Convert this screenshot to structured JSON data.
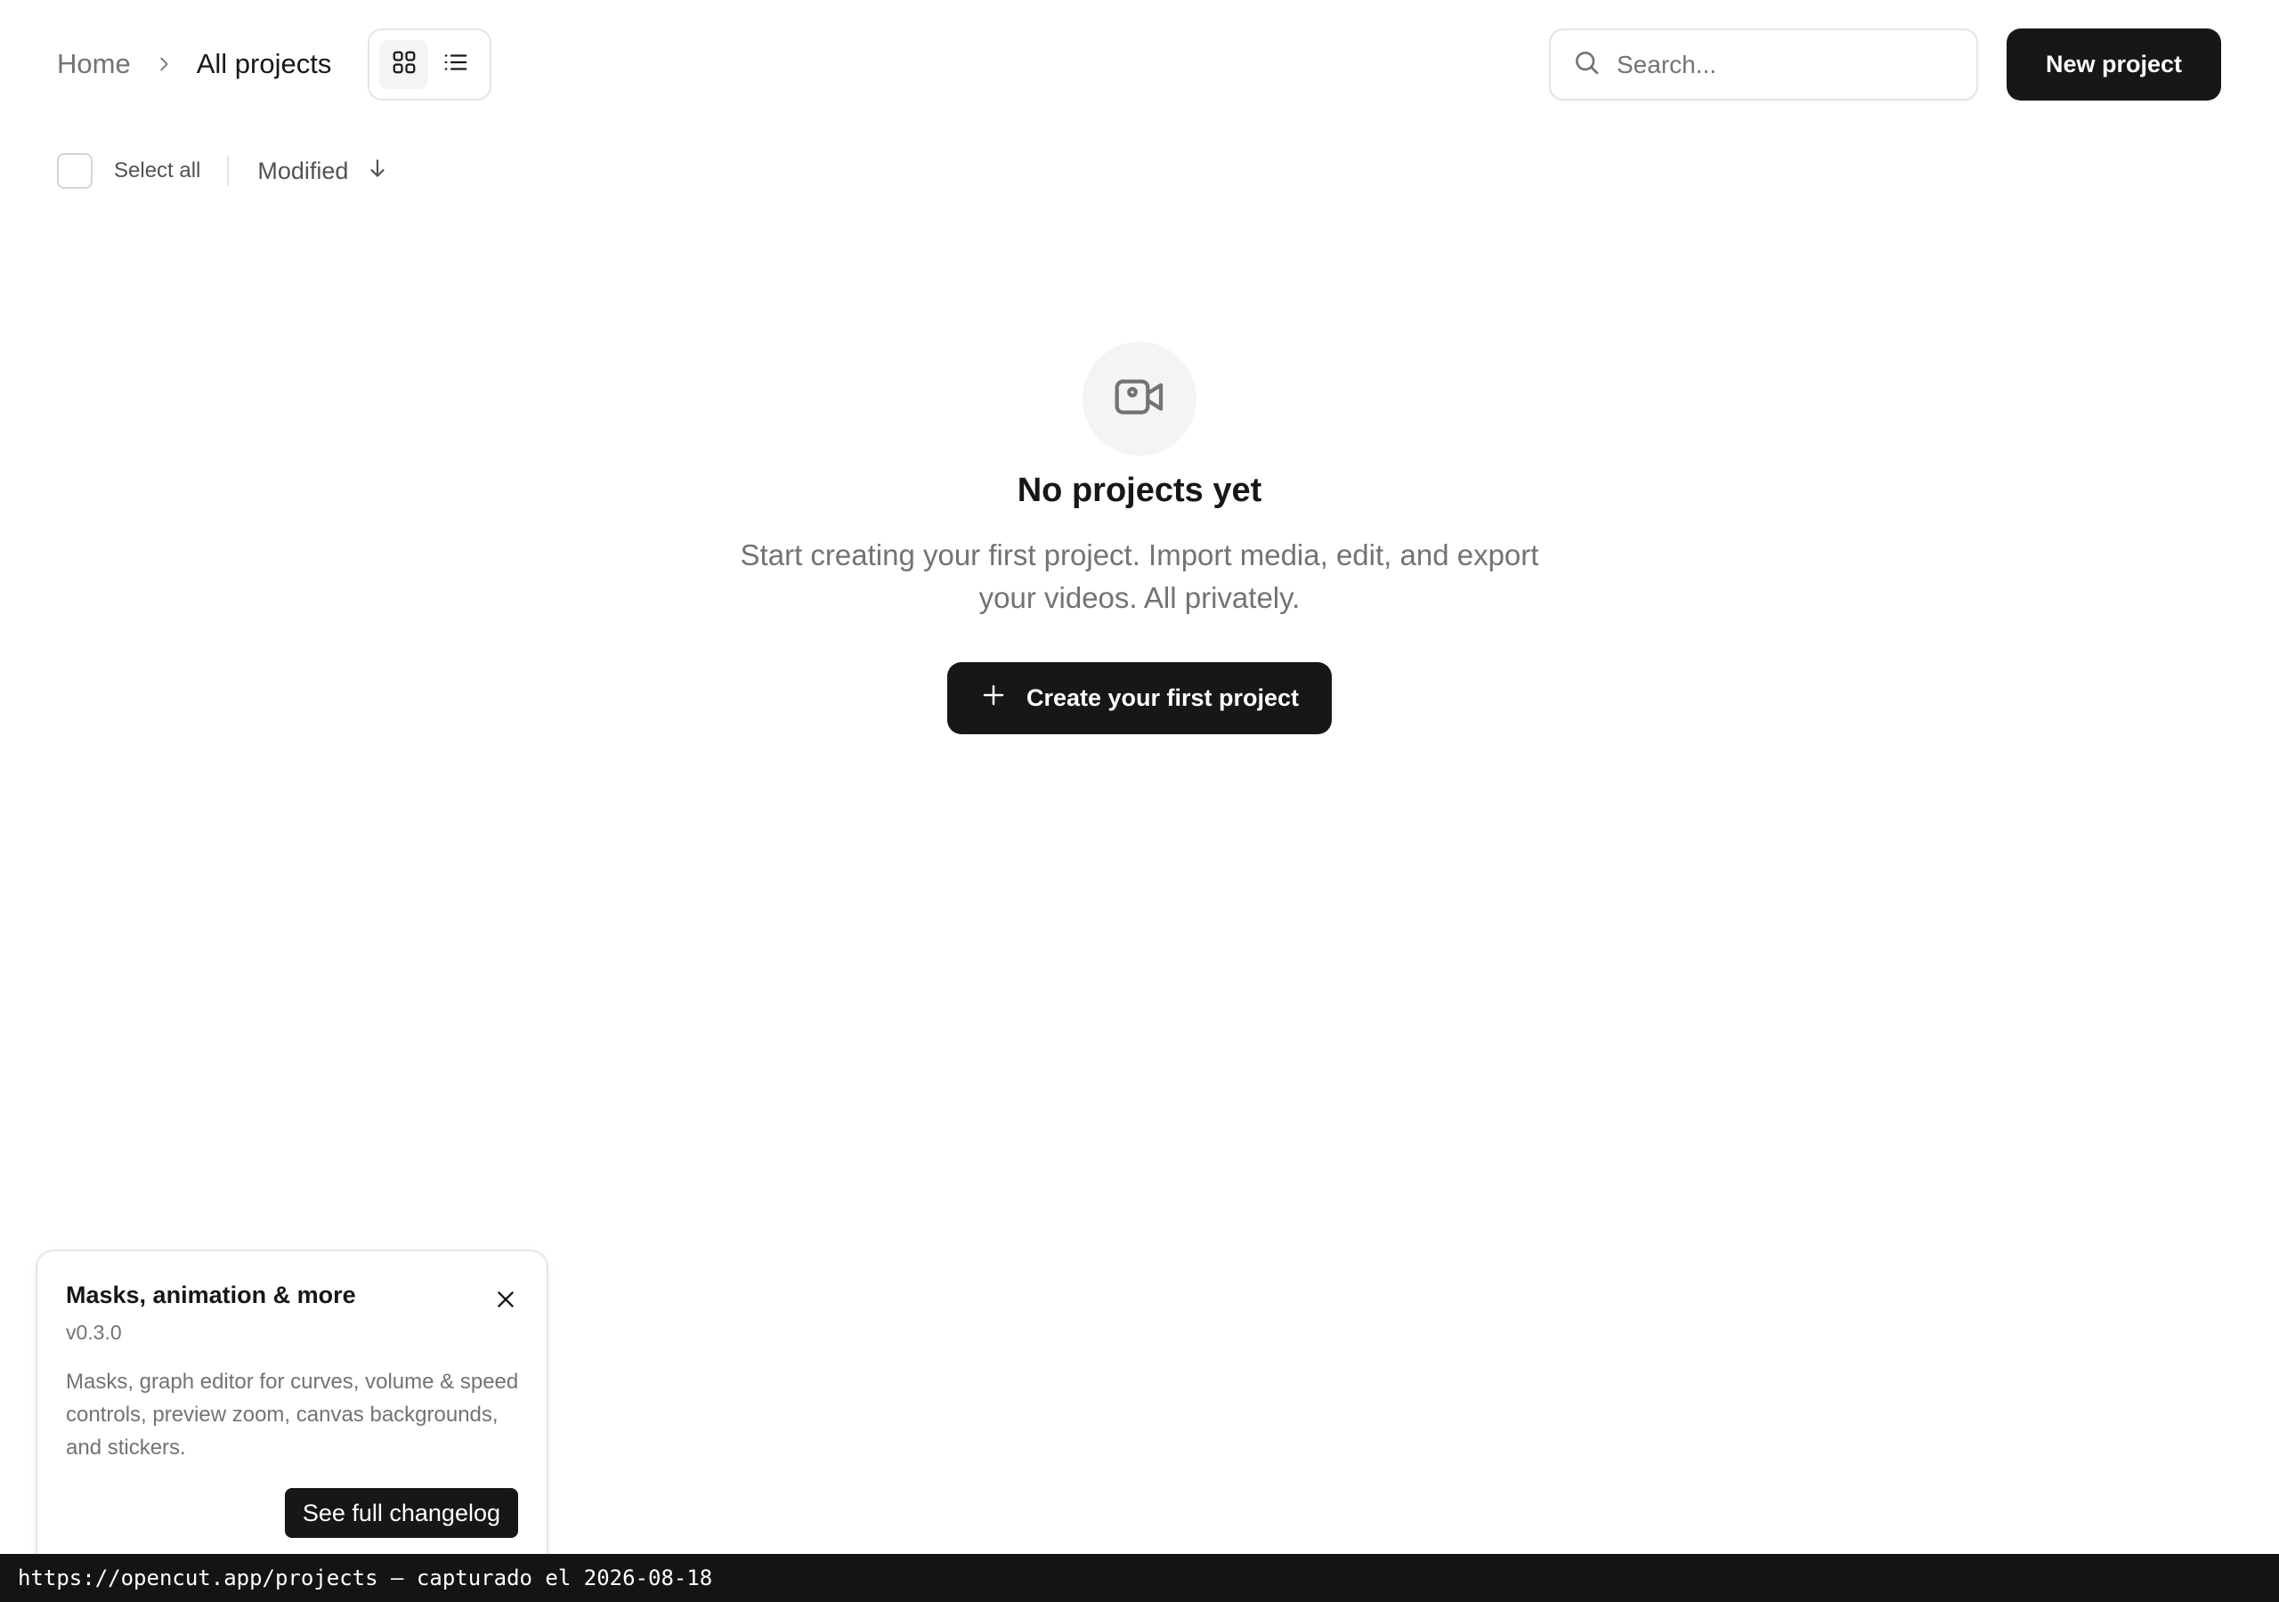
{
  "header": {
    "breadcrumb": {
      "home": "Home",
      "current": "All projects"
    },
    "view_toggle": {
      "grid_icon": "grid-icon",
      "list_icon": "list-icon",
      "active": "grid"
    },
    "search": {
      "placeholder": "Search...",
      "value": "",
      "icon": "search-icon"
    },
    "new_project_label": "New project"
  },
  "toolbar": {
    "select_all_label": "Select all",
    "select_all_checked": false,
    "sort_label": "Modified",
    "sort_icon": "arrow-down-icon"
  },
  "empty_state": {
    "icon": "video-camera-icon",
    "title": "No projects yet",
    "description": "Start creating your first project. Import media, edit, and export your videos. All privately.",
    "button_label": "Create your first project",
    "button_icon": "plus-icon"
  },
  "changelog": {
    "title": "Masks, animation & more",
    "version": "v0.3.0",
    "description": "Masks, graph editor for curves, volume & speed controls, preview zoom, canvas backgrounds, and stickers.",
    "button_label": "See full changelog",
    "close_icon": "close-icon"
  },
  "statusbar": {
    "text": "https://opencut.app/projects — capturado el 2026-08-18"
  },
  "colors": {
    "primary": "#171717",
    "muted_text": "#737373",
    "border": "#e5e5e5",
    "icon_bg": "#f4f4f5",
    "statusbar_bg": "#141414"
  }
}
